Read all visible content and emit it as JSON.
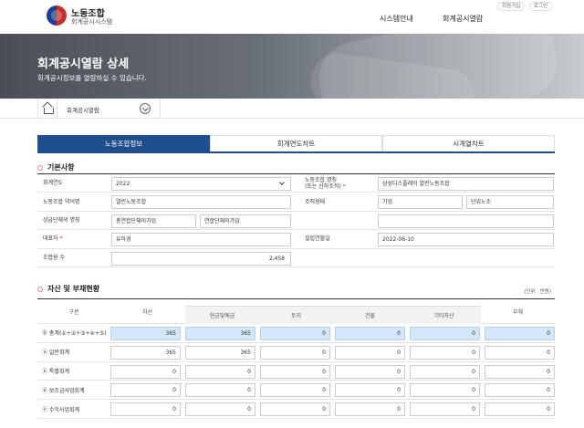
{
  "header": {
    "brand_title": "노동조합",
    "brand_subtitle": "회계공시시스템",
    "nav": [
      "시스템안내",
      "회계공시열람"
    ],
    "util": [
      "회원가입",
      "로그인"
    ]
  },
  "banner": {
    "title": "회계공시열람 상세",
    "subtitle": "회계공시정보를 열람하실 수 있습니다."
  },
  "breadcrumb": {
    "label": "회계공시열람"
  },
  "tabs": [
    "노동조합정보",
    "회계연도차트",
    "시계열차트"
  ],
  "basic": {
    "section_title": "기본사항",
    "labels": {
      "fiscal_year": "회계연도",
      "union_name_1": "노동조합 명칭",
      "union_name_2": "(또는 산하조직)",
      "abbr": "노동조합 약어명",
      "org_type": "조직형태",
      "parent": "상급단체의 명칭",
      "representative": "대표자",
      "founded": "설립연월일",
      "members": "조합원 수"
    },
    "values": {
      "fiscal_year": "2022",
      "union_name": "삼성디스플레이 열린노동조합",
      "abbr": "열린노동조합",
      "org_type_1": "기업",
      "org_type_2": "단위노조",
      "parent_1": "총연합단체미가입",
      "parent_2": "연합단체미가입",
      "representative": "유하경",
      "founded": "2022-06-10",
      "members": "2,458"
    },
    "required_mark": "*"
  },
  "assets": {
    "section_title": "자산 및 부채현황",
    "unit": "(단위 : 만원)",
    "headers": {
      "category": "구분",
      "asset": "자산",
      "cash": "현금및예금",
      "land": "토지",
      "building": "건물",
      "other": "기타자산",
      "debt": "부채"
    },
    "rows": [
      {
        "label": "⓪ 총계(①+②+③+④+⑤)",
        "values": [
          "365",
          "365",
          "0",
          "0",
          "0",
          "0"
        ]
      },
      {
        "label": "ⓐ 일반회계",
        "values": [
          "365",
          "365",
          "0",
          "0",
          "0",
          "0"
        ]
      },
      {
        "label": "ⓑ 특별회계",
        "values": [
          "0",
          "0",
          "0",
          "0",
          "0",
          "0"
        ]
      },
      {
        "label": "ⓓ 보조금사업회계",
        "values": [
          "0",
          "0",
          "0",
          "0",
          "0",
          "0"
        ]
      },
      {
        "label": "ⓔ 수익사업회계",
        "values": [
          "0",
          "0",
          "0",
          "0",
          "0",
          "0"
        ]
      }
    ]
  },
  "colors": {
    "primary": "#1f4e8c",
    "highlight": "#d3e6fa",
    "required": "#dd3333"
  }
}
